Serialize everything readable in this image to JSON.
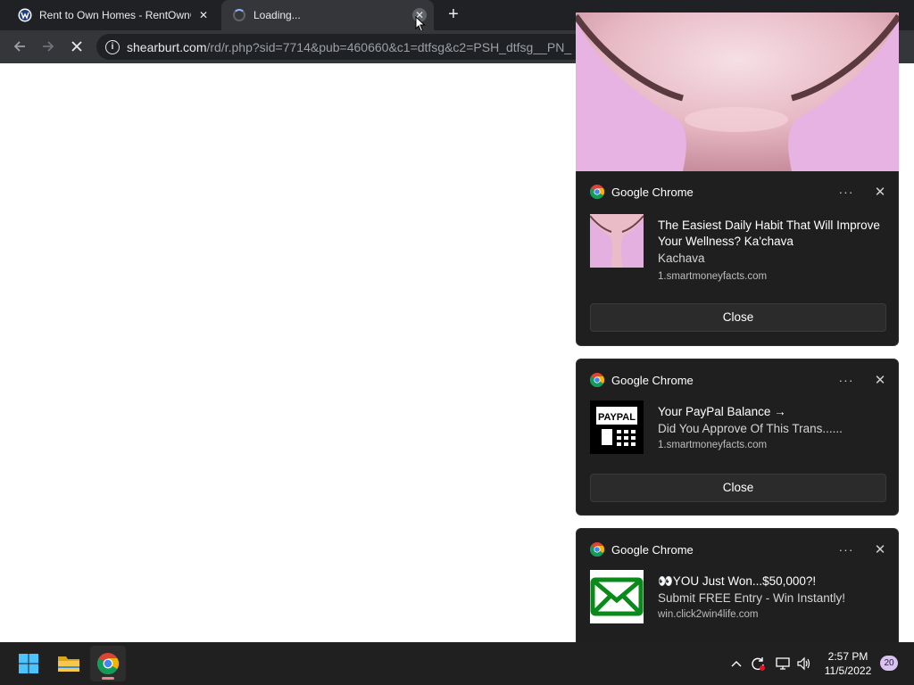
{
  "browser": {
    "tabs": [
      {
        "title": "Rent to Own Homes - RentOwnC",
        "state": "inactive"
      },
      {
        "title": "Loading...",
        "state": "active-loading"
      }
    ],
    "new_tab_label": "+",
    "address": {
      "host": "shearburt.com",
      "path": "/rd/r.php?sid=7714&pub=460660&c1=dtfsg&c2=PSH_dtfsg__PN_"
    },
    "toolbar": {
      "back_icon": "arrow-left-icon",
      "forward_icon": "arrow-right-icon",
      "stop_icon": "stop-loading-icon"
    }
  },
  "notifications": [
    {
      "app": "Google Chrome",
      "title": "The Easiest Daily Habit That Will Improve Your Wellness? Ka'chava",
      "subtitle": "Kachava",
      "source": "1.smartmoneyfacts.com",
      "close_label": "Close",
      "image": "pink-shake-photo"
    },
    {
      "app": "Google Chrome",
      "title": "Your PayPal Balance →",
      "subtitle": "Did You Approve Of This Trans......",
      "source": "1.smartmoneyfacts.com",
      "close_label": "Close",
      "image": "paypal-terminal-icon",
      "image_text": "PAYPAL"
    },
    {
      "app": "Google Chrome",
      "title": "👀YOU Just Won...$50,000?!",
      "subtitle": "Submit FREE Entry - Win Instantly!",
      "source": "win.click2win4life.com",
      "image": "green-envelope-icon"
    }
  ],
  "taskbar": {
    "apps": [
      "windows-start-icon",
      "file-explorer-icon",
      "chrome-icon"
    ],
    "tray_icons": [
      "chevron-up-icon",
      "sync-icon",
      "network-icon",
      "volume-icon"
    ],
    "time": "2:57 PM",
    "date": "11/5/2022",
    "notification_count": "20"
  },
  "colors": {
    "tabstrip": "#202124",
    "toolbar": "#35363a",
    "notification_bg": "#1f1f1f",
    "taskbar": "#202020",
    "envelope_green": "#0a8a1a",
    "badge": "#d8c2f0"
  }
}
